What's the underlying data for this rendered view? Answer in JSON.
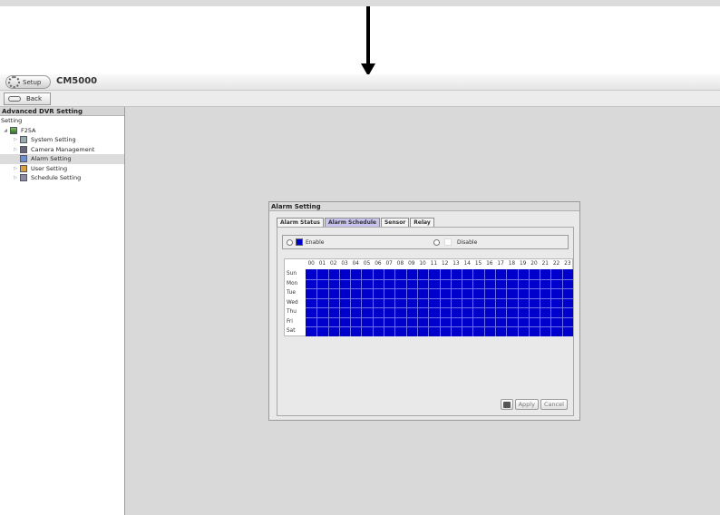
{
  "app": {
    "setup_label": "Setup",
    "title": "CM5000"
  },
  "toolbar": {
    "back_label": "Back"
  },
  "sidebar": {
    "header": "Advanced DVR Setting",
    "root_label": "Setting",
    "device": "F25A",
    "items": [
      {
        "label": "System Setting",
        "icon": "system-icon"
      },
      {
        "label": "Camera Management",
        "icon": "camera-icon"
      },
      {
        "label": "Alarm Setting",
        "icon": "alarm-icon",
        "selected": true
      },
      {
        "label": "User Setting",
        "icon": "user-icon"
      },
      {
        "label": "Schedule Setting",
        "icon": "schedule-icon"
      }
    ]
  },
  "dialog": {
    "title": "Alarm Setting",
    "tabs": [
      "Alarm Status",
      "Alarm Schedule",
      "Sensor",
      "Relay"
    ],
    "active_tab": "Alarm Schedule",
    "legend": {
      "enable_label": "Enable",
      "disable_label": "Disable",
      "enable_color": "#0000cc",
      "disable_color": "#ffffff"
    },
    "schedule": {
      "hours": [
        "00",
        "01",
        "02",
        "03",
        "04",
        "05",
        "06",
        "07",
        "08",
        "09",
        "10",
        "11",
        "12",
        "13",
        "14",
        "15",
        "16",
        "17",
        "18",
        "19",
        "20",
        "21",
        "22",
        "23"
      ],
      "days": [
        "Sun",
        "Mon",
        "Tue",
        "Wed",
        "Thu",
        "Fri",
        "Sat"
      ],
      "all_enabled": true
    },
    "buttons": {
      "apply": "Apply",
      "cancel": "Cancel"
    }
  }
}
